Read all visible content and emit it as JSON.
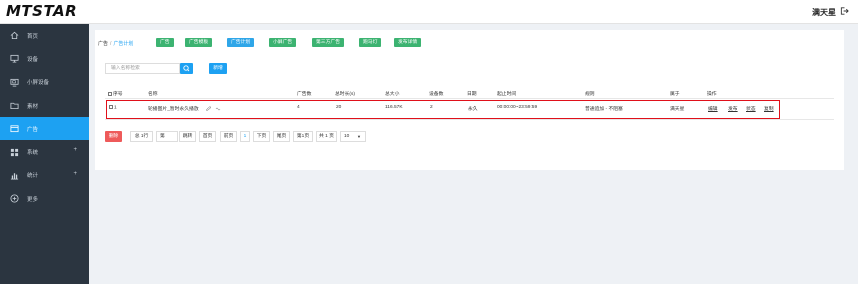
{
  "app": {
    "logo": "MTSTAR",
    "user": "满天星"
  },
  "sidebar": {
    "items": [
      {
        "label": "首页",
        "icon": "home-icon",
        "expandable": false,
        "active": false
      },
      {
        "label": "设备",
        "icon": "monitor-icon",
        "expandable": false,
        "active": false
      },
      {
        "label": "小屏设备",
        "icon": "small-screen-icon",
        "expandable": false,
        "active": false
      },
      {
        "label": "素材",
        "icon": "folder-icon",
        "expandable": false,
        "active": false
      },
      {
        "label": "广告",
        "icon": "ad-icon",
        "expandable": false,
        "active": true
      },
      {
        "label": "系统",
        "icon": "grid-icon",
        "expandable": true,
        "active": false
      },
      {
        "label": "统计",
        "icon": "bar-chart-icon",
        "expandable": true,
        "active": false
      },
      {
        "label": "更多",
        "icon": "plus-circle-icon",
        "expandable": false,
        "active": false
      }
    ],
    "expand_symbol": "+"
  },
  "breadcrumb": {
    "root": "广告",
    "separator": "/",
    "current": "广告计划"
  },
  "tabs": [
    "广告",
    "广告模板",
    "广告计划",
    "小屏广告",
    "第三方广告",
    "跑马灯",
    "发布详情"
  ],
  "toolbar": {
    "search_placeholder": "输入名称检索",
    "add_label": "新增"
  },
  "table": {
    "headers": [
      "序号",
      "名称",
      "广告数",
      "总时长(s)",
      "总大小",
      "设备数",
      "日期",
      "起止时间",
      "规则",
      "属于",
      "操作"
    ],
    "rows": [
      {
        "index": "1",
        "name": "轮播图片_暂时永久播放",
        "ads": "4",
        "duration": "20",
        "size": "116.57K",
        "devices": "2",
        "date": "永久",
        "time": "00:00:00~23:59:59",
        "rule": "普通追加 - 不阻塞",
        "owner": "满天星",
        "actions": [
          "编辑",
          "发布",
          "状态",
          "复制"
        ]
      }
    ]
  },
  "footer": {
    "delete_label": "删除",
    "total_label": "总 1行",
    "page_input_value": "第",
    "goto_label": "跳转",
    "first_label": "首页",
    "prev_label": "前页",
    "current_page": "1",
    "next_label": "下页",
    "last_label": "尾页",
    "page_info": "第1页",
    "total_pages": "共 1 页",
    "page_size": "10"
  },
  "colors": {
    "accent": "#1da1f2",
    "tab_green": "#3cb371",
    "sidebar_bg": "#2b3540",
    "danger": "#ee5a5a",
    "highlight_border": "#e0101a"
  }
}
